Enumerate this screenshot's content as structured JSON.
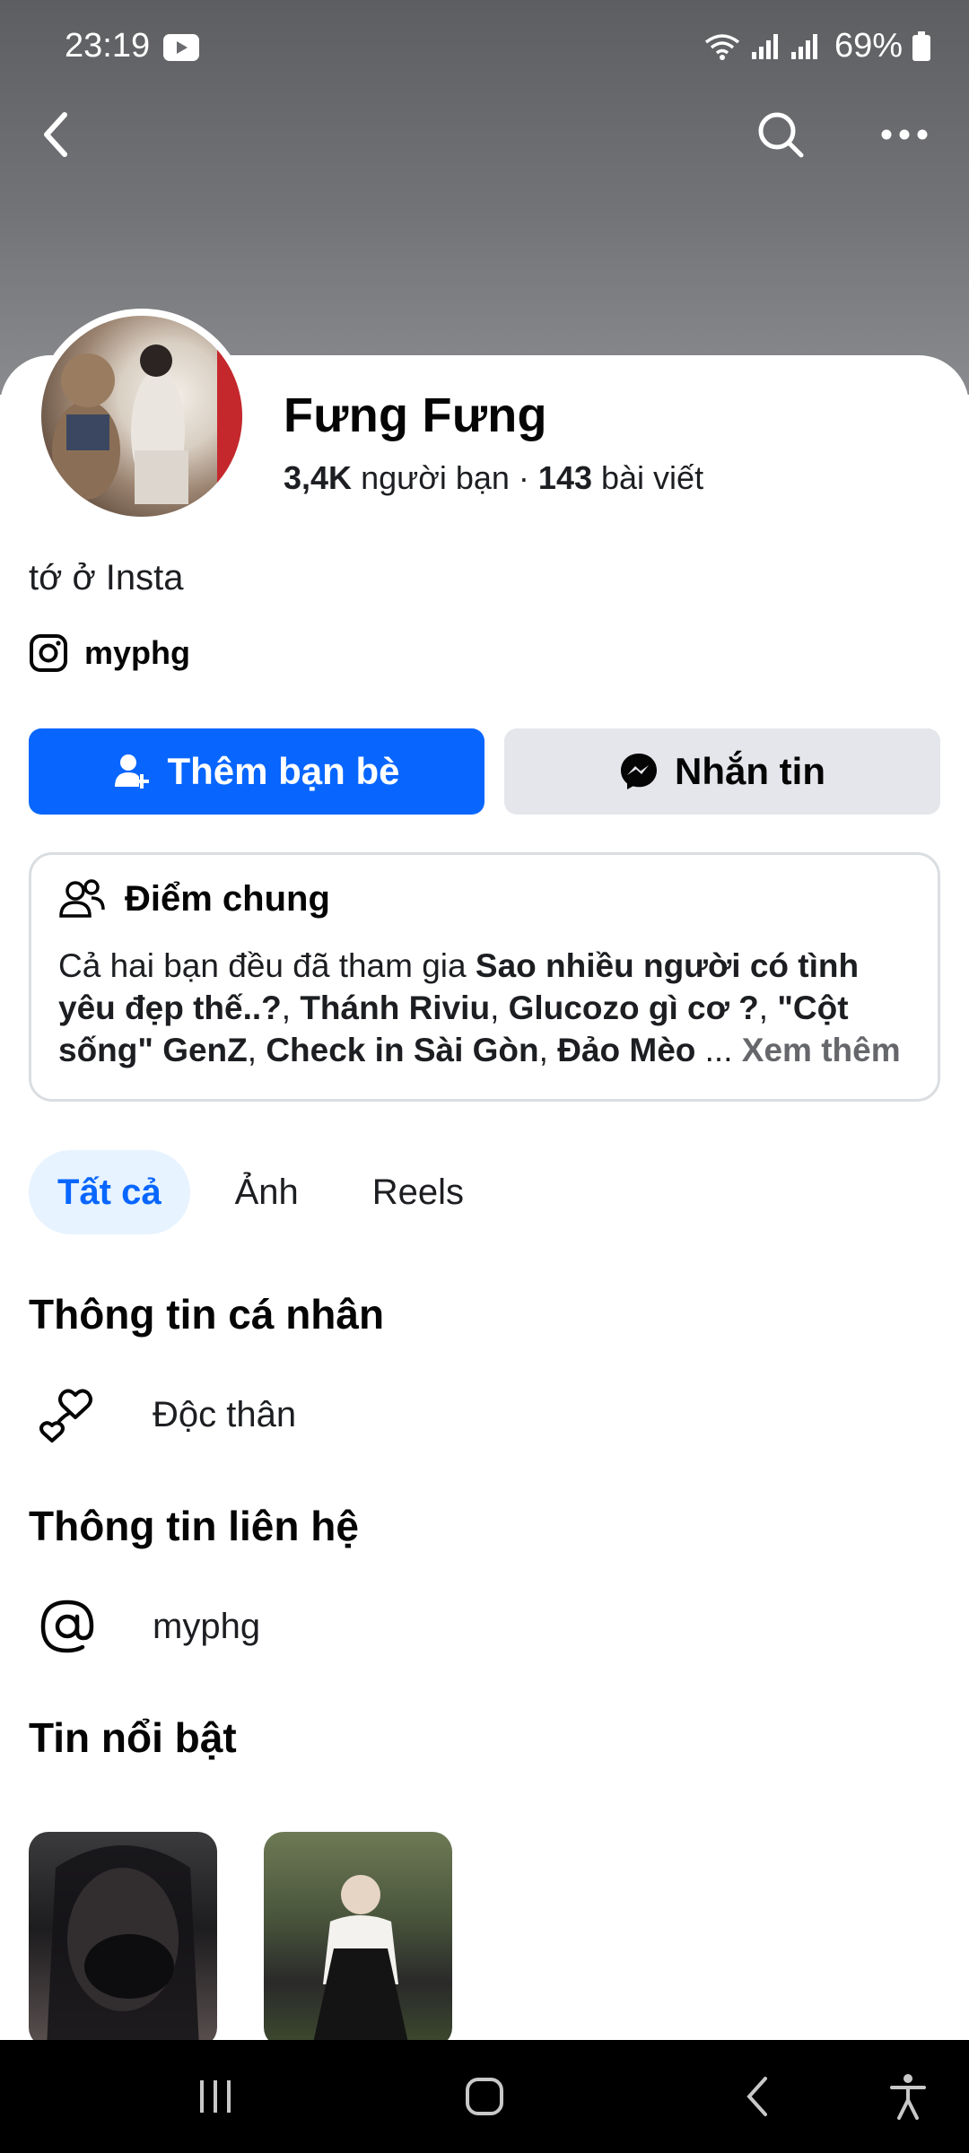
{
  "status_bar": {
    "time": "23:19",
    "battery": "69%"
  },
  "profile": {
    "name": "Fưng Fưng",
    "friends_count": "3,4K",
    "friends_label": "người bạn",
    "separator": "·",
    "posts_count": "143",
    "posts_label": "bài viết",
    "bio": "tớ ở Insta",
    "instagram": "myphg"
  },
  "actions": {
    "add_friend": "Thêm bạn bè",
    "message": "Nhắn tin"
  },
  "mutual": {
    "title": "Điểm chung",
    "intro": "Cả hai bạn đều đã tham gia ",
    "groups": [
      "Sao nhiều người có tình yêu đẹp thế..?",
      "Thánh Riviu",
      "Glucozo gì cơ ?",
      "\"Cột sống\" GenZ",
      "Check in Sài Gòn",
      "Đảo Mèo"
    ],
    "sep": ", ",
    "ellipsis": " ... ",
    "see_more": "Xem thêm"
  },
  "tabs": [
    {
      "label": "Tất cả",
      "active": true
    },
    {
      "label": "Ảnh",
      "active": false
    },
    {
      "label": "Reels",
      "active": false
    }
  ],
  "sections": {
    "personal_title": "Thông tin cá nhân",
    "relationship": "Độc thân",
    "contact_title": "Thông tin liên hệ",
    "contact_handle": "myphg",
    "highlights_title": "Tin nổi bật"
  },
  "icons": {
    "back": "chevron-left-icon",
    "search": "search-icon",
    "more": "more-horizontal-icon",
    "add_friend": "person-add-icon",
    "messenger": "messenger-icon",
    "mutual": "people-icon",
    "relationship": "hearts-icon",
    "contact": "at-sign-icon",
    "instagram": "instagram-icon"
  },
  "colors": {
    "accent": "#0866ff",
    "secondary_button": "#e4e6eb",
    "active_tab_bg": "#e7f3ff",
    "muted_text": "#65676b"
  }
}
